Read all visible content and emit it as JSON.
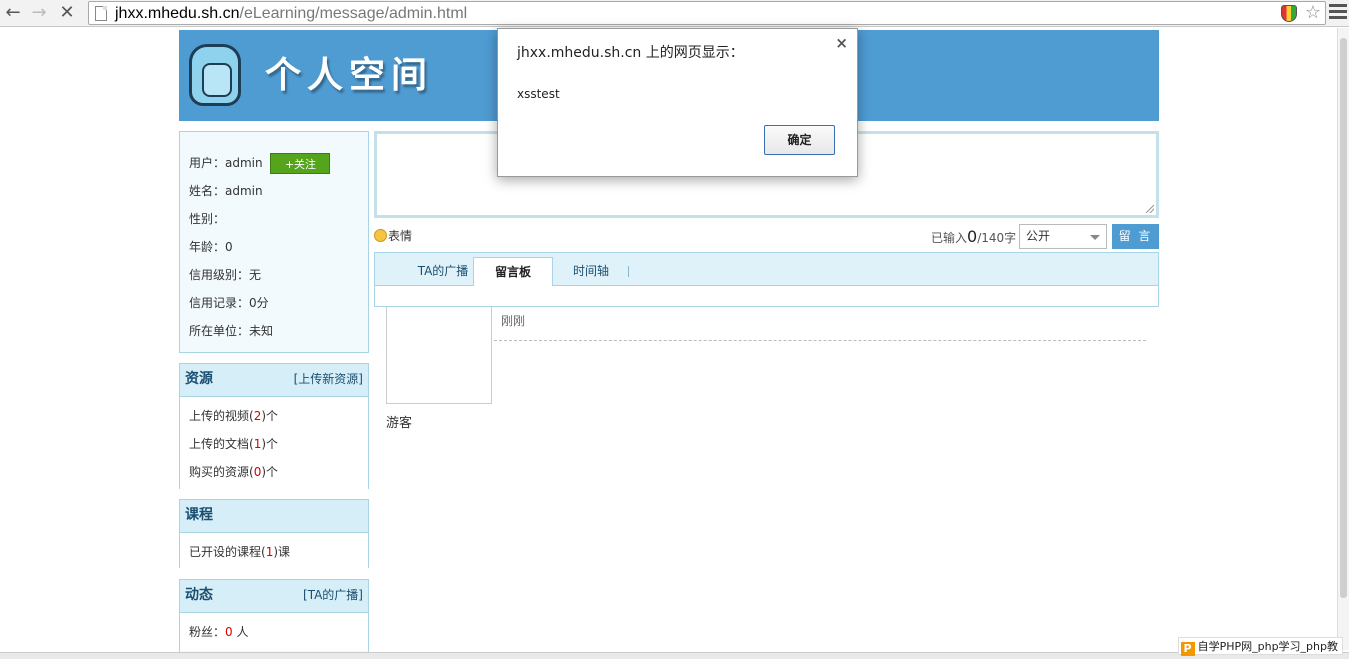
{
  "browser": {
    "url_host": "jhxx.mhedu.sh.cn",
    "url_path": "/eLearning/message/admin.html"
  },
  "header": {
    "title": "个人空间"
  },
  "profile": {
    "user_label": "用户：",
    "user_value": "admin",
    "follow_label": "+关注",
    "name_label": "姓名：",
    "name_value": "admin",
    "gender_label": "性别：",
    "age_label": "年龄：",
    "age_value": "0",
    "credit_level_label": "信用级别：",
    "credit_level_value": "无",
    "credit_record_label": "信用记录：",
    "credit_record_value": "0分",
    "org_label": "所在单位：",
    "org_value": "未知"
  },
  "resources": {
    "title": "资源",
    "upload_link": "[上传新资源]",
    "videos_pre": "上传的视频(",
    "videos_num": "2",
    "videos_post": ")个",
    "docs_pre": "上传的文档(",
    "docs_num": "1",
    "docs_post": ")个",
    "bought_pre": "购买的资源(",
    "bought_num": "0",
    "bought_post": ")个"
  },
  "courses": {
    "title": "课程",
    "opened_pre": "已开设的课程(",
    "opened_num": "1",
    "opened_post": ")课"
  },
  "activity": {
    "title": "动态",
    "link": "[TA的广播]",
    "fans_pre": "粉丝：",
    "fans_num": "0",
    "fans_post": " 人"
  },
  "composer": {
    "emoji_label": "表情",
    "counter_pre": "已输入",
    "counter_num": "0",
    "counter_post": "/140字",
    "visibility": "公开",
    "post_button": "留 言"
  },
  "tabs": [
    {
      "label": "TA的广播"
    },
    {
      "label": "留言板"
    },
    {
      "label": "时间轴"
    }
  ],
  "message": {
    "author": "游客",
    "time": "刚刚"
  },
  "dialog": {
    "title": "jhxx.mhedu.sh.cn 上的网页显示：",
    "message": "xsstest",
    "ok": "确定",
    "close": "×"
  },
  "watermark": {
    "text": "自学PHP网_php学习_php教"
  }
}
